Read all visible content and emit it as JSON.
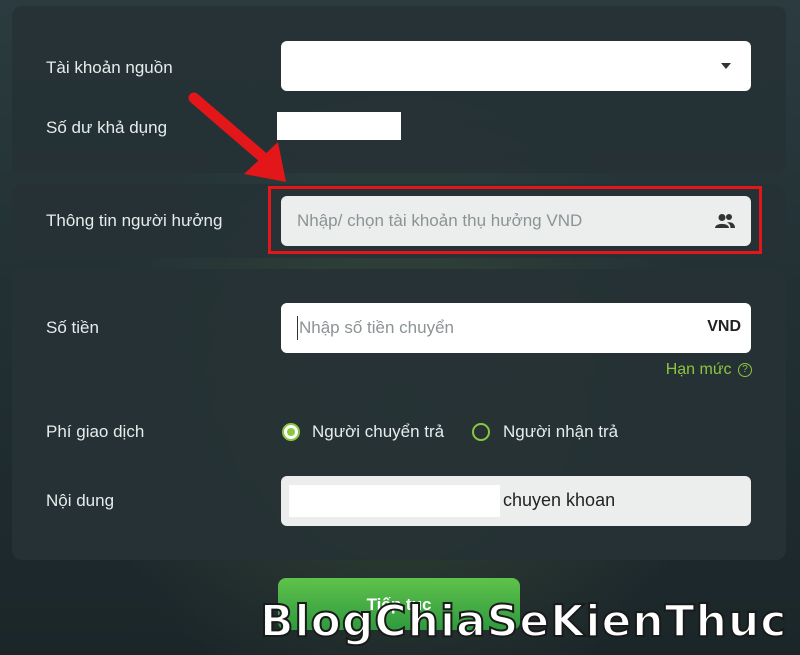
{
  "source_account": {
    "label": "Tài khoản nguồn"
  },
  "balance": {
    "label": "Số dư khả dụng"
  },
  "beneficiary": {
    "label": "Thông tin người hưởng",
    "placeholder": "Nhập/ chọn tài khoản thụ hưởng VND"
  },
  "amount": {
    "label": "Số tiền",
    "placeholder": "Nhập số tiền chuyển",
    "currency": "VND",
    "limit_link": "Hạn mức"
  },
  "fee": {
    "label": "Phí giao dịch",
    "options": [
      {
        "label": "Người chuyển trả",
        "selected": true
      },
      {
        "label": "Người nhận trả",
        "selected": false
      }
    ]
  },
  "content": {
    "label": "Nội dung",
    "value_suffix": "chuyen khoan"
  },
  "continue_button": {
    "label": "Tiếp tục"
  },
  "watermark": {
    "text": "BlogChiaSeKienThuc"
  },
  "colors": {
    "accent": "#8cc63f",
    "highlight": "#e3161a"
  }
}
